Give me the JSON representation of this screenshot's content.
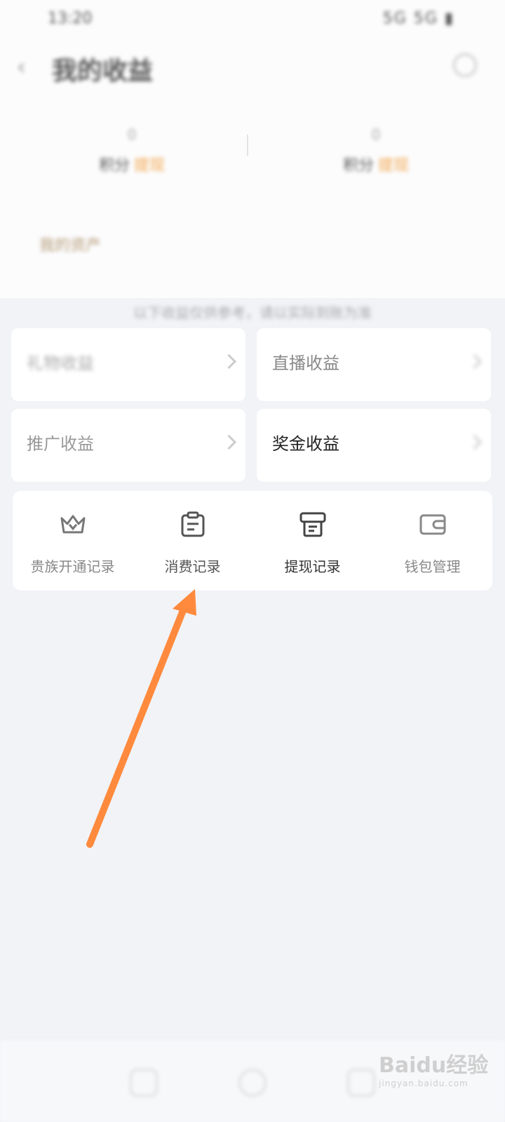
{
  "status_bar": {
    "time": "13:20",
    "icons": "5G 5G ▮"
  },
  "header": {
    "title": "我的收益",
    "back_label": "‹"
  },
  "stats": [
    {
      "value": "0",
      "label": "积分",
      "suffix": "提现"
    },
    {
      "value": "0",
      "label": "积分",
      "suffix": "提现"
    }
  ],
  "assets_link": "我的资产",
  "notice": "以下收益仅供参考，请以实际到账为准",
  "cards": [
    {
      "label": "礼物收益"
    },
    {
      "label": "直播收益"
    },
    {
      "label": "推广收益"
    },
    {
      "label": "奖金收益"
    }
  ],
  "actions": [
    {
      "label": "贵族开通记录",
      "icon": "crown-icon"
    },
    {
      "label": "消费记录",
      "icon": "clipboard-icon"
    },
    {
      "label": "提现记录",
      "icon": "printer-icon"
    },
    {
      "label": "钱包管理",
      "icon": "wallet-icon"
    }
  ],
  "watermark": {
    "brand": "Baidu经验",
    "url": "jingyan.baidu.com"
  },
  "colors": {
    "accent": "#f2a64b",
    "arrow": "#ff8a3d",
    "background": "#f1f3f7"
  }
}
